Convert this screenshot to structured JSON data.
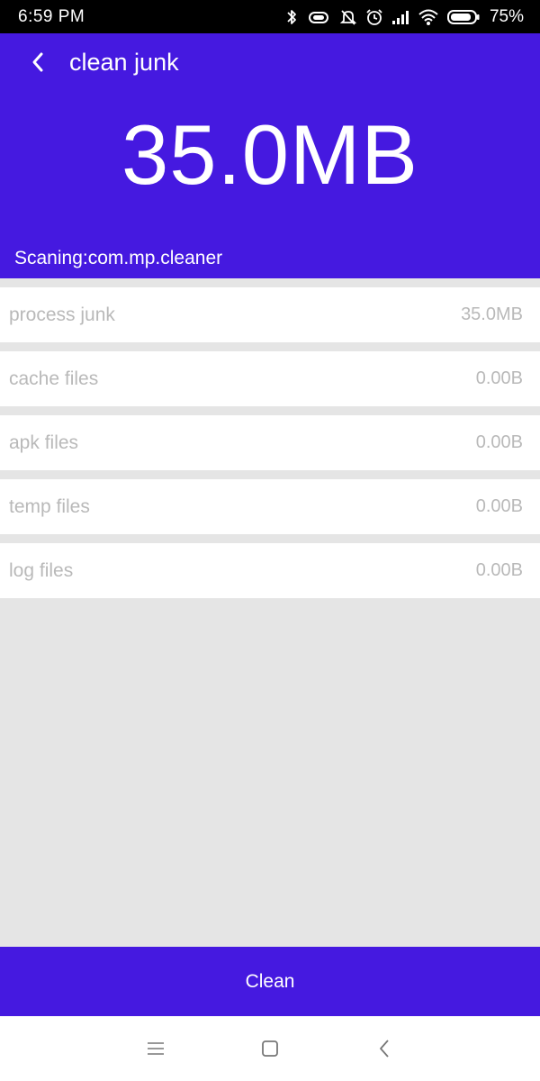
{
  "status_bar": {
    "time": "6:59  PM",
    "battery": "75%",
    "icons": [
      "bluetooth-icon",
      "vibrate-icon",
      "mute-alert-icon",
      "alarm-icon",
      "signal-icon",
      "wifi-icon",
      "battery-icon"
    ]
  },
  "header": {
    "title": "clean junk",
    "total_size": "35.0MB",
    "scan_status": "Scaning:com.mp.cleaner",
    "background_color": "#4519e0"
  },
  "junk_items": [
    {
      "label": "process junk",
      "size": "35.0MB"
    },
    {
      "label": "cache files",
      "size": "0.00B"
    },
    {
      "label": "apk files",
      "size": "0.00B"
    },
    {
      "label": "temp files",
      "size": "0.00B"
    },
    {
      "label": "log files",
      "size": "0.00B"
    }
  ],
  "clean_button": {
    "label": "Clean"
  },
  "nav_bar": {
    "icons": [
      "menu-icon",
      "home-icon",
      "back-icon"
    ]
  }
}
